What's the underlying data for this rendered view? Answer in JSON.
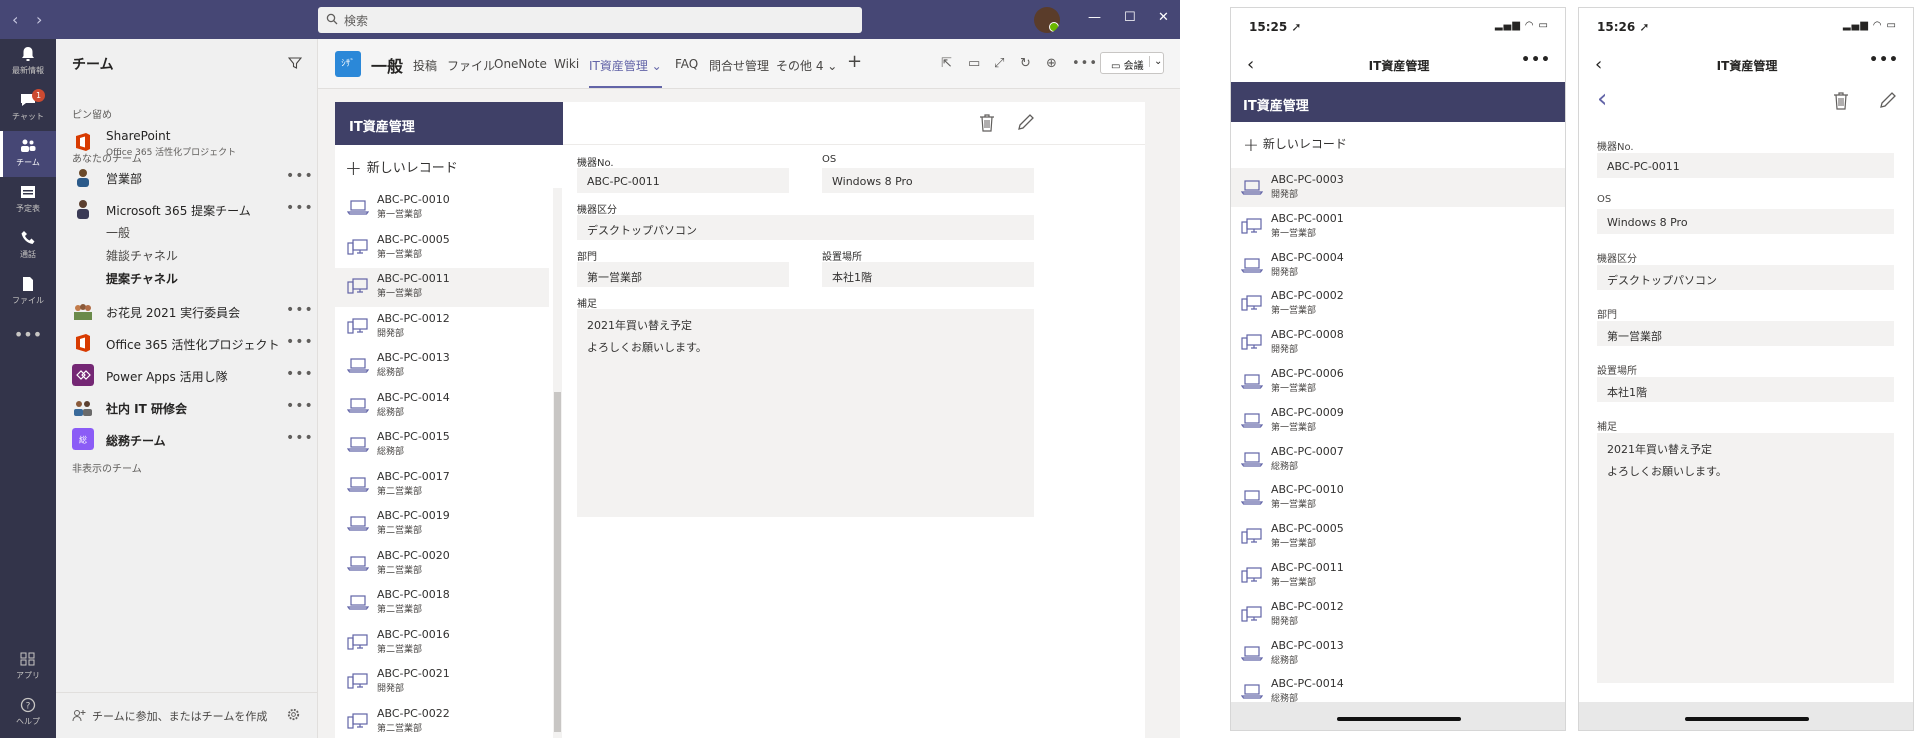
{
  "search": {
    "placeholder": "検索"
  },
  "rail": [
    {
      "label": "最新情報",
      "icon": "bell-icon"
    },
    {
      "label": "チャット",
      "icon": "chat-icon",
      "badge": "1"
    },
    {
      "label": "チーム",
      "icon": "teams-icon"
    },
    {
      "label": "予定表",
      "icon": "calendar-icon"
    },
    {
      "label": "通話",
      "icon": "phone-icon"
    },
    {
      "label": "ファイル",
      "icon": "file-icon"
    },
    {
      "label": "アプリ",
      "icon": "apps-icon"
    },
    {
      "label": "ヘルプ",
      "icon": "help-icon"
    }
  ],
  "teams_panel": {
    "title": "チーム",
    "pinned_label": "ピン留め",
    "pinned": {
      "name": "SharePoint",
      "sub": "Office 365 活性化プロジェクト"
    },
    "your_teams_label": "あなたのチーム",
    "teams": [
      {
        "name": "営業部"
      },
      {
        "name": "Microsoft 365 提案チーム"
      },
      {
        "name": "お花見 2021 実行委員会"
      },
      {
        "name": "Office 365 活性化プロジェクト"
      },
      {
        "name": "Power Apps 活用し隊"
      },
      {
        "name": "社内 IT 研修会"
      },
      {
        "name": "総務チーム"
      }
    ],
    "channels": [
      "一般",
      "雑談チャネル",
      "提案チャネル"
    ],
    "hidden_label": "非表示のチーム",
    "footer_label": "チームに参加、またはチームを作成"
  },
  "channel_header": {
    "badge": "ｼｻﾞ",
    "name": "一般",
    "tabs": [
      "投稿",
      "ファイル",
      "OneNote",
      "Wiki",
      "IT資産管理 ⌄",
      "FAQ",
      "問合せ管理",
      "その他 4 ⌄"
    ],
    "meet_label": "会議"
  },
  "app": {
    "list_title": "IT資産管理",
    "new_record": "新しいレコード",
    "records": [
      {
        "id": "ABC-PC-0010",
        "dept": "第一営業部",
        "type": "laptop"
      },
      {
        "id": "ABC-PC-0005",
        "dept": "第一営業部",
        "type": "desktop"
      },
      {
        "id": "ABC-PC-0011",
        "dept": "第一営業部",
        "type": "desktop",
        "selected": true
      },
      {
        "id": "ABC-PC-0012",
        "dept": "開発部",
        "type": "desktop"
      },
      {
        "id": "ABC-PC-0013",
        "dept": "総務部",
        "type": "laptop"
      },
      {
        "id": "ABC-PC-0014",
        "dept": "総務部",
        "type": "laptop"
      },
      {
        "id": "ABC-PC-0015",
        "dept": "総務部",
        "type": "laptop"
      },
      {
        "id": "ABC-PC-0017",
        "dept": "第二営業部",
        "type": "laptop"
      },
      {
        "id": "ABC-PC-0019",
        "dept": "第二営業部",
        "type": "laptop"
      },
      {
        "id": "ABC-PC-0020",
        "dept": "第二営業部",
        "type": "laptop"
      },
      {
        "id": "ABC-PC-0018",
        "dept": "第二営業部",
        "type": "laptop"
      },
      {
        "id": "ABC-PC-0016",
        "dept": "第二営業部",
        "type": "desktop"
      },
      {
        "id": "ABC-PC-0021",
        "dept": "開発部",
        "type": "desktop"
      },
      {
        "id": "ABC-PC-0022",
        "dept": "第二営業部",
        "type": "desktop"
      }
    ],
    "detail": {
      "device_no_label": "機器No.",
      "device_no": "ABC-PC-0011",
      "os_label": "OS",
      "os": "Windows 8 Pro",
      "category_label": "機器区分",
      "category": "デスクトップパソコン",
      "dept_label": "部門",
      "dept": "第一営業部",
      "location_label": "設置場所",
      "location": "本社1階",
      "notes_label": "補足",
      "notes_line1": "2021年買い替え予定",
      "notes_line2": "よろしくお願いします。"
    }
  },
  "phone1": {
    "time": "15:25 ➚",
    "title": "IT資産管理",
    "list_title": "IT資産管理",
    "new_record": "新しいレコード",
    "records": [
      {
        "id": "ABC-PC-0003",
        "dept": "開発部",
        "type": "laptop",
        "selected": true
      },
      {
        "id": "ABC-PC-0001",
        "dept": "第一営業部",
        "type": "desktop"
      },
      {
        "id": "ABC-PC-0004",
        "dept": "開発部",
        "type": "laptop"
      },
      {
        "id": "ABC-PC-0002",
        "dept": "第一営業部",
        "type": "desktop"
      },
      {
        "id": "ABC-PC-0008",
        "dept": "開発部",
        "type": "desktop"
      },
      {
        "id": "ABC-PC-0006",
        "dept": "第一営業部",
        "type": "laptop"
      },
      {
        "id": "ABC-PC-0009",
        "dept": "第一営業部",
        "type": "laptop"
      },
      {
        "id": "ABC-PC-0007",
        "dept": "総務部",
        "type": "laptop"
      },
      {
        "id": "ABC-PC-0010",
        "dept": "第一営業部",
        "type": "laptop"
      },
      {
        "id": "ABC-PC-0005",
        "dept": "第一営業部",
        "type": "desktop"
      },
      {
        "id": "ABC-PC-0011",
        "dept": "第一営業部",
        "type": "desktop"
      },
      {
        "id": "ABC-PC-0012",
        "dept": "開発部",
        "type": "desktop"
      },
      {
        "id": "ABC-PC-0013",
        "dept": "総務部",
        "type": "laptop"
      },
      {
        "id": "ABC-PC-0014",
        "dept": "総務部",
        "type": "laptop"
      }
    ]
  },
  "phone2": {
    "time": "15:26 ➚",
    "title": "IT資産管理"
  },
  "colors": {
    "teams_purple": "#464775",
    "rail_dark": "#33344a",
    "app_header": "#3f4067",
    "accent": "#6264a7"
  }
}
